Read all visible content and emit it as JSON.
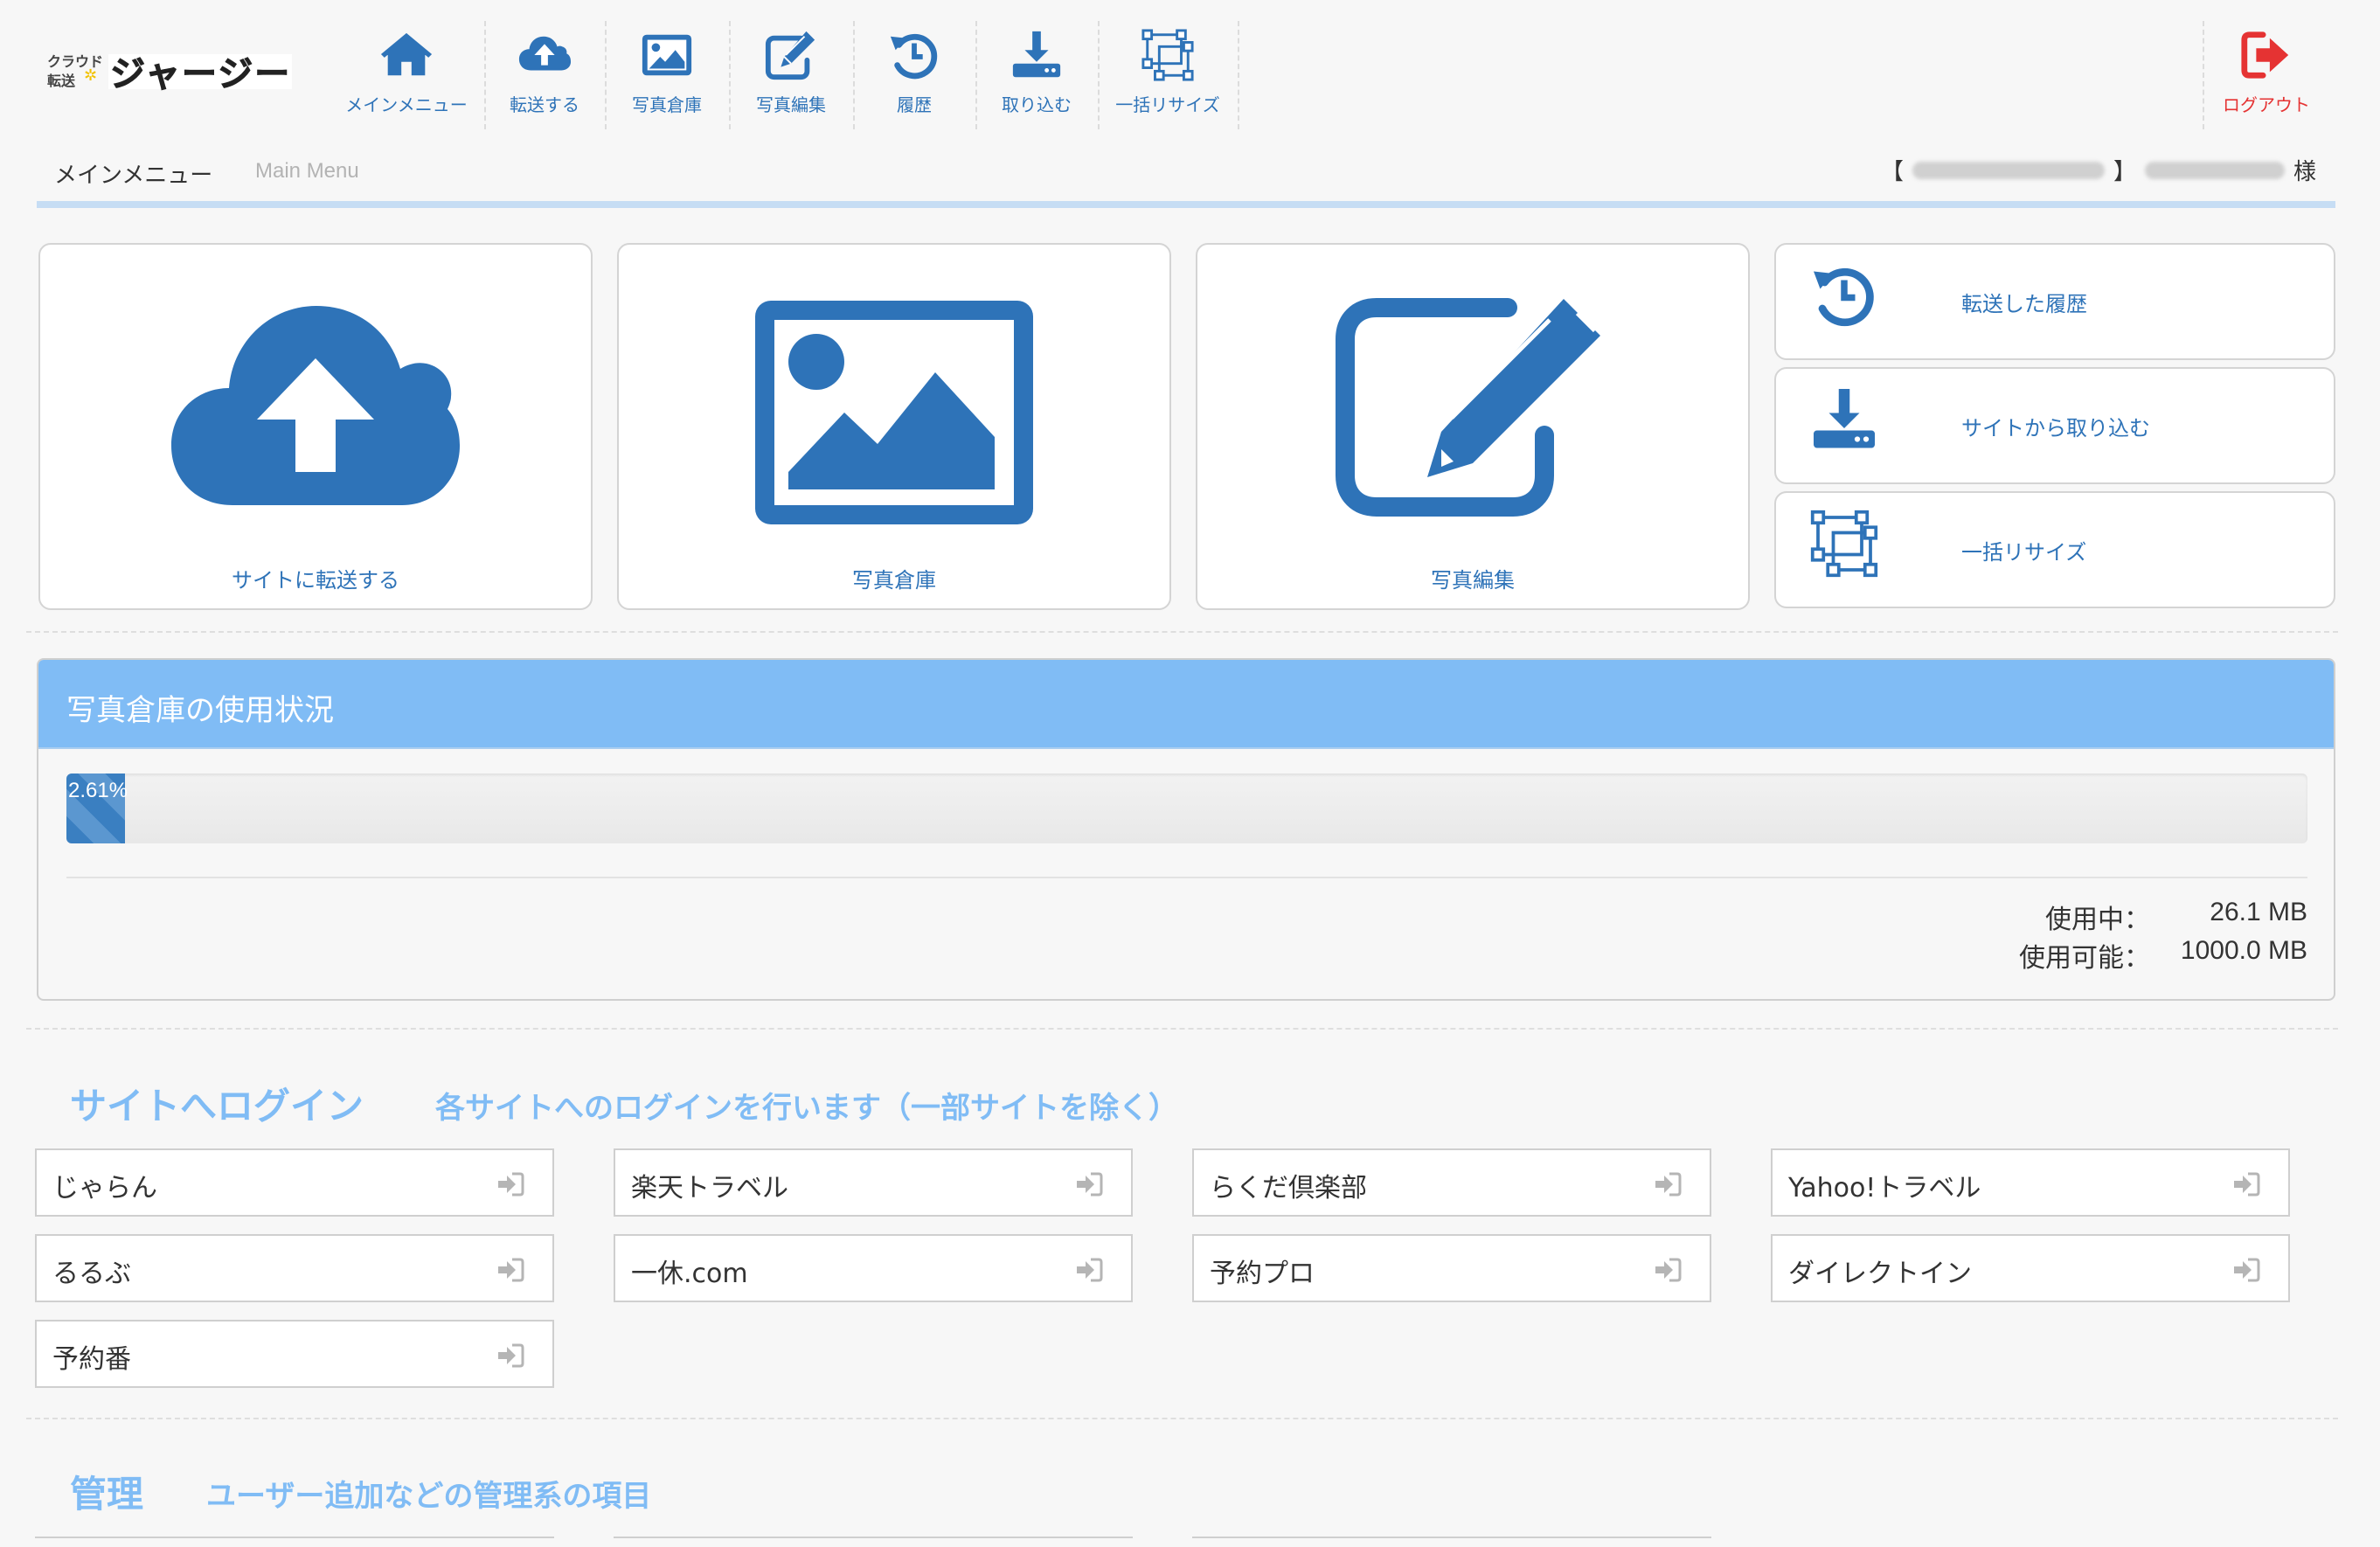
{
  "header": {
    "logo_alt": "クラウド転送 ジャージー",
    "nav": [
      {
        "label": "メインメニュー",
        "icon": "home-icon"
      },
      {
        "label": "転送する",
        "icon": "cloud-upload-icon"
      },
      {
        "label": "写真倉庫",
        "icon": "image-icon"
      },
      {
        "label": "写真編集",
        "icon": "edit-icon"
      },
      {
        "label": "履歴",
        "icon": "history-icon"
      },
      {
        "label": "取り込む",
        "icon": "download-icon"
      },
      {
        "label": "一括リサイズ",
        "icon": "resize-icon"
      }
    ],
    "logout_label": "ログアウト"
  },
  "breadcrumb": {
    "title_ja": "メインメニュー",
    "title_en": "Main Menu",
    "user_open": "【",
    "user_close": "】",
    "user_suffix": "様"
  },
  "tiles": {
    "main": [
      {
        "label": "サイトに転送する",
        "icon": "cloud-upload-icon"
      },
      {
        "label": "写真倉庫",
        "icon": "image-icon"
      },
      {
        "label": "写真編集",
        "icon": "edit-icon"
      }
    ],
    "side": [
      {
        "label": "転送した履歴",
        "icon": "history-icon"
      },
      {
        "label": "サイトから取り込む",
        "icon": "download-icon"
      },
      {
        "label": "一括リサイズ",
        "icon": "resize-icon"
      }
    ]
  },
  "usage": {
    "title": "写真倉庫の使用状況",
    "percent_label": "2.61%",
    "percent": 2.61,
    "used_key": "使用中：",
    "used_value": "26.1 MB",
    "avail_key": "使用可能：",
    "avail_value": "1000.0 MB"
  },
  "login_section": {
    "title": "サイトへログイン",
    "subtitle": "各サイトへのログインを行います（一部サイトを除く）",
    "sites": [
      "じゃらん",
      "楽天トラベル",
      "らくだ倶楽部",
      "Yahoo!トラベル",
      "るるぶ",
      "一休.com",
      "予約プロ",
      "ダイレクトイン",
      "予約番"
    ]
  },
  "admin_section": {
    "title": "管理",
    "subtitle": "ユーザー追加などの管理系の項目"
  },
  "colors": {
    "primary": "#2e73b8",
    "light_blue": "#80bcf5",
    "logout_red": "#e53333"
  }
}
